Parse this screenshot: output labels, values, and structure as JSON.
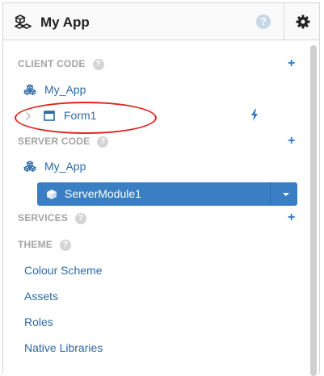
{
  "header": {
    "title": "My App",
    "help": "?"
  },
  "client_code": {
    "title": "CLIENT CODE",
    "help": "?",
    "add": "+",
    "items": [
      {
        "label": "My_App"
      },
      {
        "label": "Form1"
      }
    ]
  },
  "server_code": {
    "title": "SERVER CODE",
    "help": "?",
    "add": "+",
    "items": [
      {
        "label": "My_App"
      },
      {
        "label": "ServerModule1"
      }
    ]
  },
  "services": {
    "title": "SERVICES",
    "help": "?",
    "add": "+"
  },
  "theme": {
    "title": "THEME",
    "help": "?",
    "items": [
      {
        "label": "Colour Scheme"
      },
      {
        "label": "Assets"
      },
      {
        "label": "Roles"
      },
      {
        "label": "Native Libraries"
      }
    ]
  },
  "colors": {
    "accent": "#2c79c1",
    "selected_bg": "#3a7ec4",
    "highlight_oval": "#e1231f"
  }
}
